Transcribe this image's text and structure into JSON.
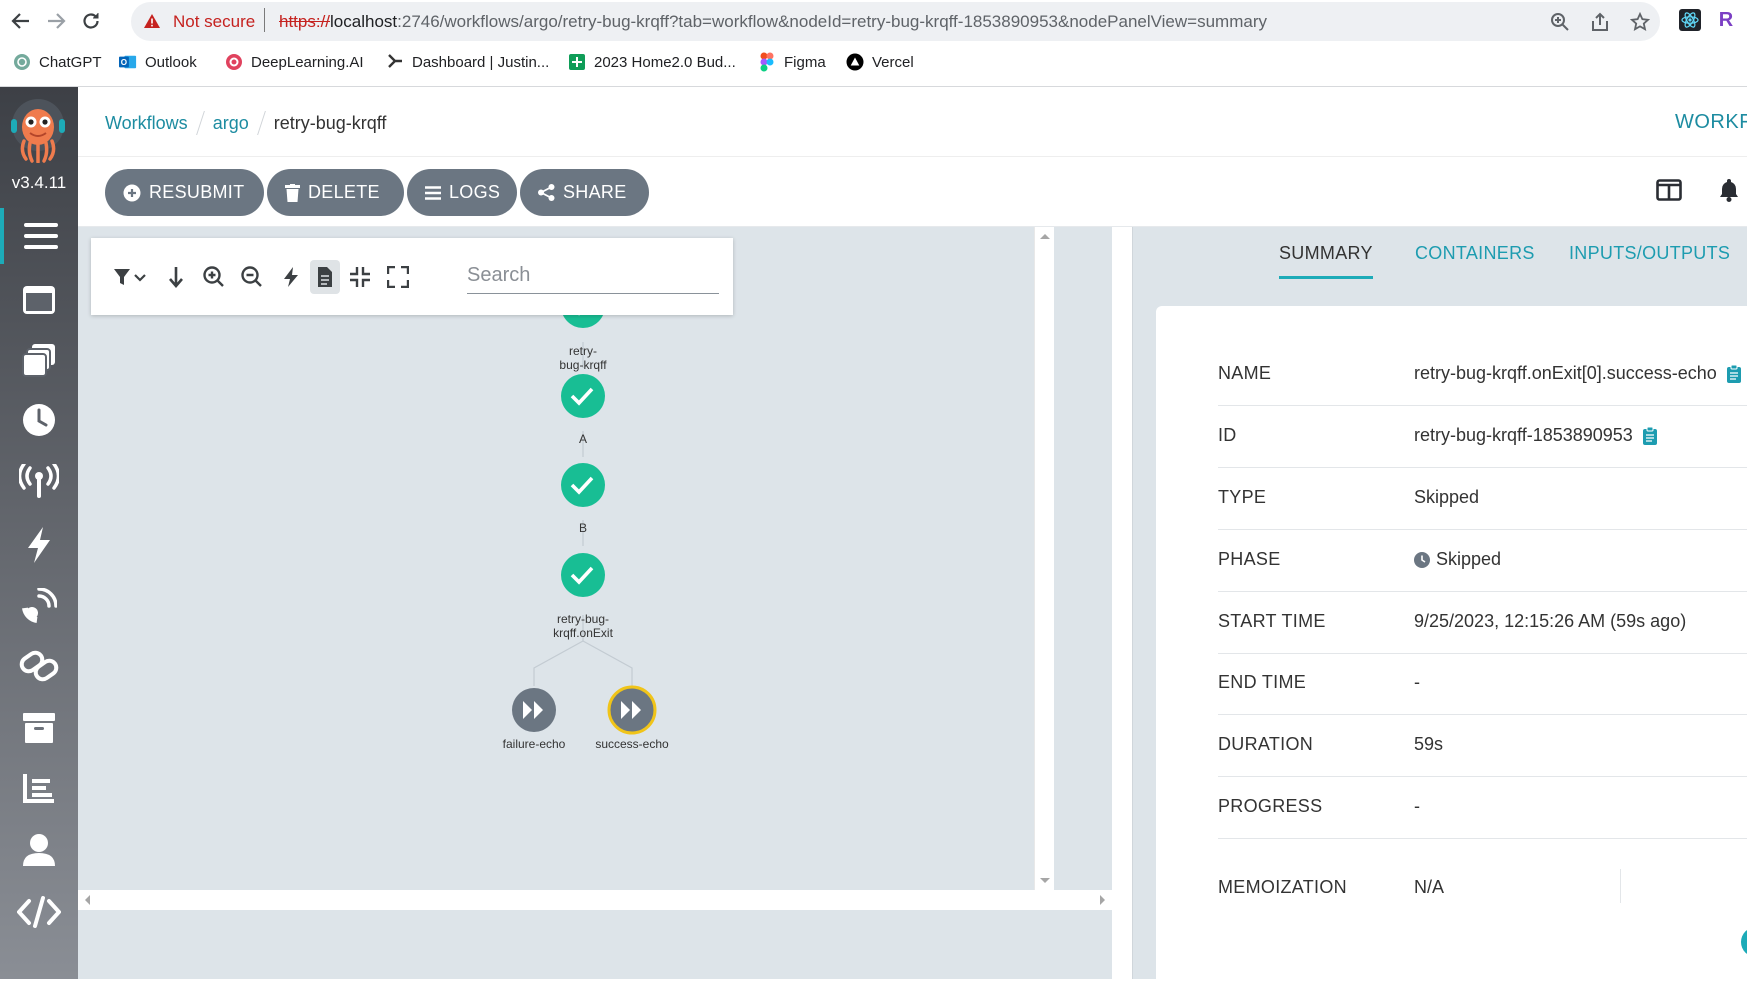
{
  "browser": {
    "security_label": "Not secure",
    "url": {
      "scheme": "https://",
      "host": "localhost",
      "rest": ":2746/workflows/argo/retry-bug-krqff?tab=workflow&nodeId=retry-bug-krqff-1853890953&nodePanelView=summary"
    },
    "profile_initial": "R",
    "bookmarks": [
      {
        "label": "ChatGPT",
        "icon": "chatgpt-icon"
      },
      {
        "label": "Outlook",
        "icon": "outlook-icon"
      },
      {
        "label": "DeepLearning.AI",
        "icon": "deeplearning-icon"
      },
      {
        "label": "Dashboard | Justin...",
        "icon": "dashboard-icon"
      },
      {
        "label": "2023 Home2.0 Bud...",
        "icon": "sheets-icon"
      },
      {
        "label": "Figma",
        "icon": "figma-icon"
      },
      {
        "label": "Vercel",
        "icon": "vercel-icon"
      }
    ]
  },
  "sidenav": {
    "version": "v3.4.11",
    "items": [
      "menu-icon",
      "workflows-icon",
      "templates-icon",
      "cron-icon",
      "event-sources-icon",
      "sensors-icon",
      "event-flow-icon",
      "links-icon",
      "archive-icon",
      "reports-icon",
      "user-icon",
      "api-docs-icon"
    ]
  },
  "breadcrumb": [
    "Workflows",
    "argo",
    "retry-bug-krqff"
  ],
  "header_title": "WORKF",
  "actions": {
    "resubmit": "RESUBMIT",
    "delete": "DELETE",
    "logs": "LOGS",
    "share": "SHARE"
  },
  "graph": {
    "search_placeholder": "Search",
    "nodes": [
      {
        "id": "root",
        "label_lines": [
          "retry-",
          "bug-krqff"
        ],
        "status": "succeeded"
      },
      {
        "id": "A",
        "label_lines": [
          "A"
        ],
        "status": "succeeded"
      },
      {
        "id": "B",
        "label_lines": [
          "B"
        ],
        "status": "succeeded"
      },
      {
        "id": "onExit",
        "label_lines": [
          "retry-bug-",
          "krqff.onExit"
        ],
        "status": "succeeded"
      },
      {
        "id": "failure",
        "label_lines": [
          "failure-echo"
        ],
        "status": "skipped"
      },
      {
        "id": "success",
        "label_lines": [
          "success-echo"
        ],
        "status": "skipped",
        "selected": true
      }
    ]
  },
  "panel": {
    "tabs": [
      "SUMMARY",
      "CONTAINERS",
      "INPUTS/OUTPUTS"
    ],
    "rows": [
      {
        "key": "NAME",
        "value": "retry-bug-krqff.onExit[0].success-echo",
        "copy": true
      },
      {
        "key": "ID",
        "value": "retry-bug-krqff-1853890953",
        "copy": true
      },
      {
        "key": "TYPE",
        "value": "Skipped"
      },
      {
        "key": "PHASE",
        "value": "Skipped",
        "phase_icon": true
      },
      {
        "key": "START TIME",
        "value": "9/25/2023, 12:15:26 AM (59s ago)"
      },
      {
        "key": "END TIME",
        "value": "-"
      },
      {
        "key": "DURATION",
        "value": "59s"
      },
      {
        "key": "PROGRESS",
        "value": "-"
      },
      {
        "key": "MEMOIZATION",
        "value": "N/A"
      }
    ]
  },
  "colors": {
    "accent": "#1dabb8",
    "success": "#18be94",
    "skipped": "#6b7682",
    "selected_ring": "#f0c419",
    "button": "#6b7682"
  }
}
